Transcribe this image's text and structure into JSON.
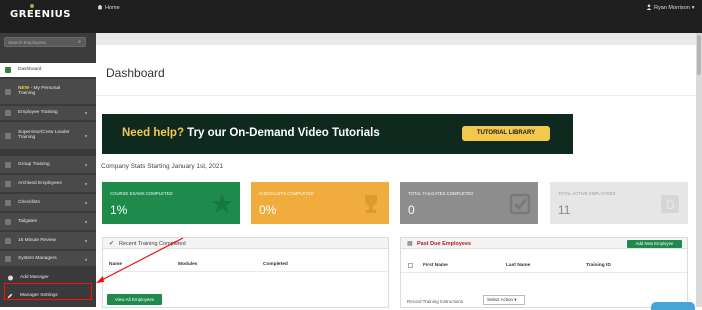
{
  "header": {
    "logo": "GREENIUS",
    "home_icon": "home-icon",
    "home_label": "Home",
    "user_icon": "user-icon",
    "user_name": "Ryan Morrison",
    "user_caret": "▾"
  },
  "sidebar": {
    "search_placeholder": "Search Employees",
    "items": [
      {
        "label": "Dashboard",
        "icon": "dashboard-icon"
      },
      {
        "label": "NEW - My Personal Training",
        "icon": "star-icon"
      },
      {
        "label": "Employee Training",
        "icon": "employee-training-icon"
      },
      {
        "label": "Supervisor/Crew Leader Training",
        "icon": "supervisor-icon"
      },
      {
        "label": "Group Training",
        "icon": "group-training-icon"
      },
      {
        "label": "Archived Employees",
        "icon": "archive-icon"
      },
      {
        "label": "Checklists",
        "icon": "checklist-icon"
      },
      {
        "label": "Tailgates",
        "icon": "tailgate-icon"
      },
      {
        "label": "15 Minute Review",
        "icon": "review-icon"
      },
      {
        "label": "System Managers",
        "icon": "managers-icon"
      },
      {
        "label": "Add Manager",
        "icon": "plus-icon"
      },
      {
        "label": "Manager Settings",
        "icon": "pencil-icon"
      }
    ],
    "new_tag": "NEW",
    "new_rest": " - My Personal",
    "new_line2": "Training"
  },
  "dashboard": {
    "title": "Dashboard",
    "banner_text_1": "Need help?",
    "banner_text_2": " Try our On-Demand Video Tutorials",
    "banner_button": "TUTORIAL LIBRARY",
    "company_stats": "Company Stats Starting January 1st, 2021"
  },
  "stats": [
    {
      "label": "COURSE EXAMS COMPLETED",
      "value": "1%",
      "color": "#1e8a4c"
    },
    {
      "label": "CHECKLISTS COMPLETED",
      "value": "0%",
      "color": "#f0ad3d"
    },
    {
      "label": "TOTAL TAILGATES COMPLETED",
      "value": "0",
      "color": "#8d8d8d"
    },
    {
      "label": "TOTAL ACTIVE EMPLOYEES",
      "value": "11",
      "color": "#e6e6e6"
    }
  ],
  "recent": {
    "title": "Recent Training Completed",
    "cols": [
      "Name",
      "Modules",
      "Completed"
    ],
    "view_all": "View All Employees"
  },
  "pastdue": {
    "title": "Past Due Employees",
    "add_new": "Add New Employee",
    "cols": [
      "First Name",
      "Last Name",
      "Training ID"
    ],
    "record_label": "Record Training Instructions",
    "select_action": "Select Action ▾"
  }
}
